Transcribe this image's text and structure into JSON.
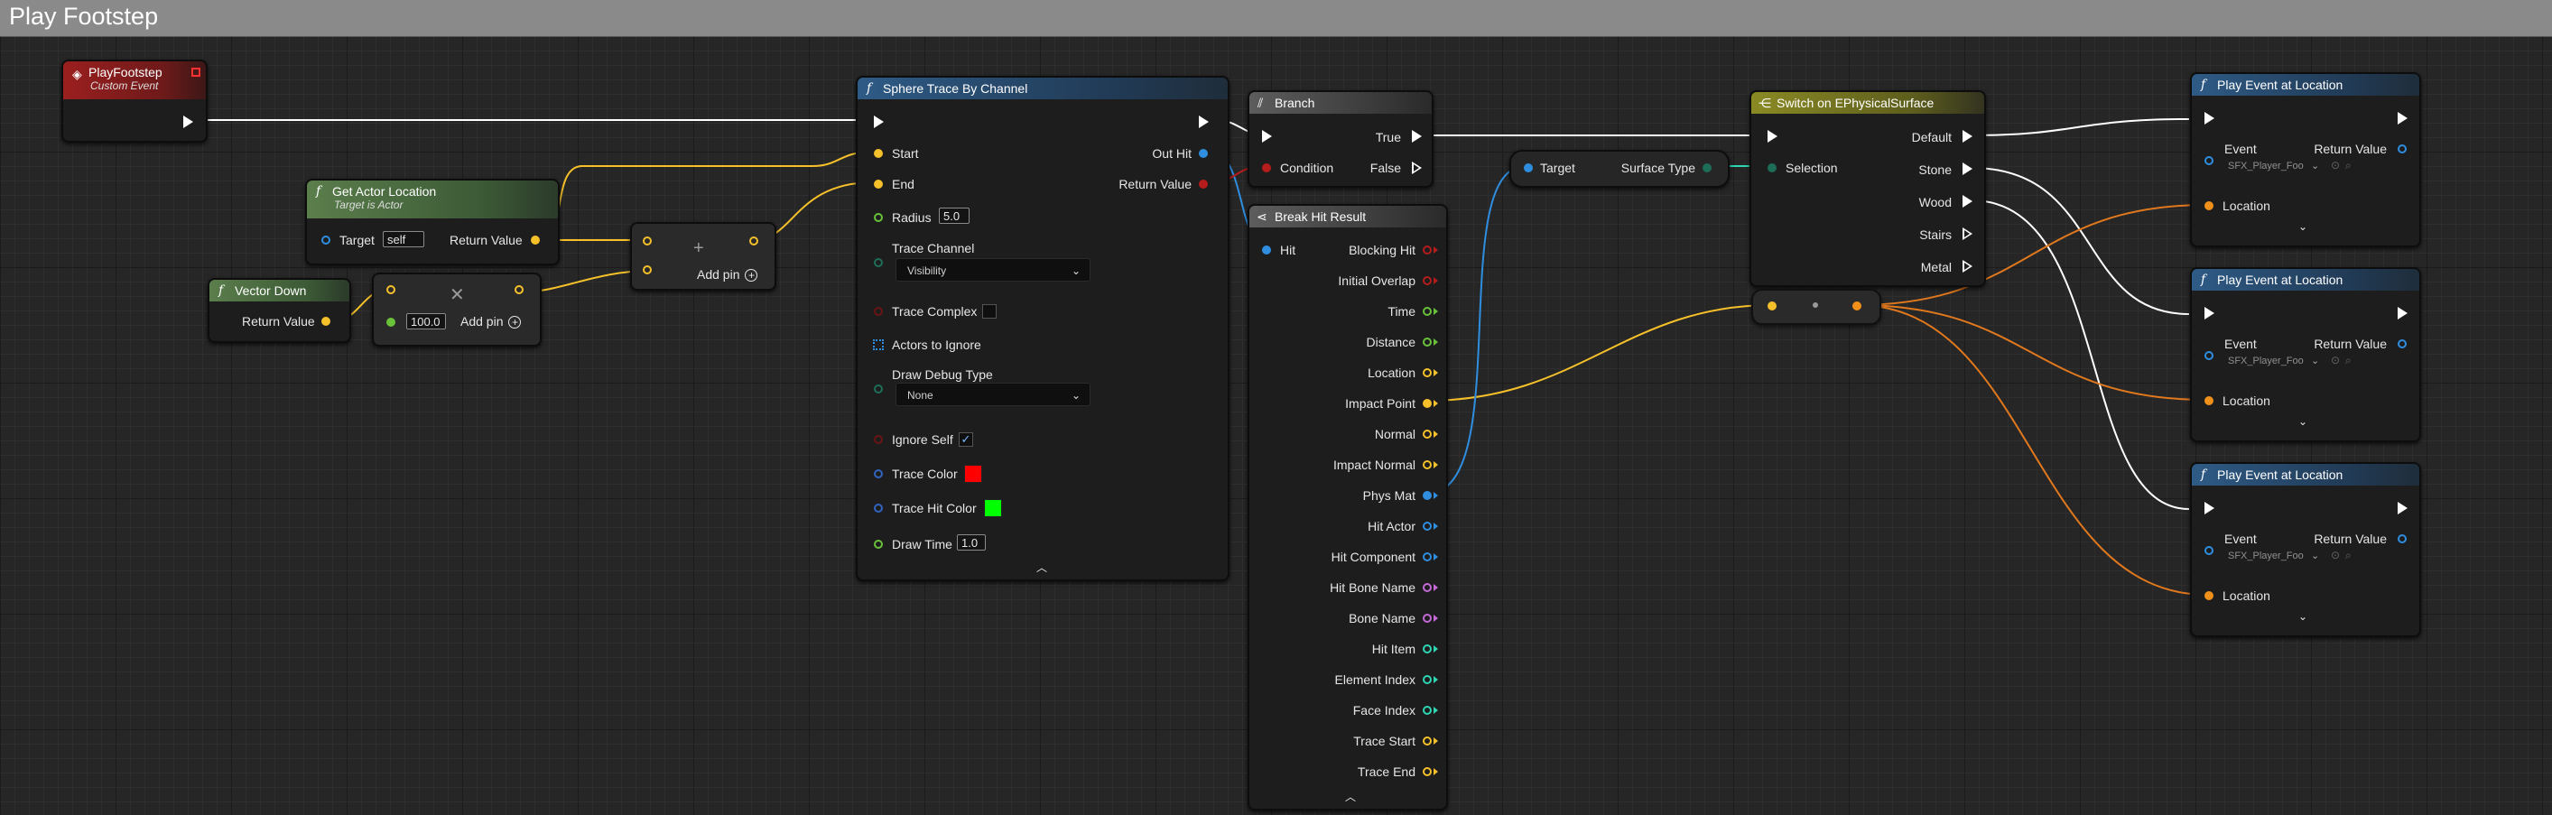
{
  "window": {
    "title": "Play Footstep"
  },
  "colors": {
    "exec": "#ffffff",
    "vector": "#f5c02a",
    "object": "#2f8ee0",
    "bool": "#b51c1c",
    "float": "#69c23a",
    "name": "#c569d8",
    "int": "#2fd6b4",
    "struct": "#f0901a",
    "wire_orange": "#e0781e"
  },
  "nodes": {
    "custom_event": {
      "title": "PlayFootstep",
      "subtitle": "Custom Event",
      "icon": "event-diamond-icon"
    },
    "get_actor_location": {
      "title": "Get Actor Location",
      "subtitle": "Target is Actor",
      "target_label": "Target",
      "target_value": "self",
      "return_label": "Return Value"
    },
    "vector_down": {
      "title": "Vector Down",
      "return_label": "Return Value"
    },
    "multiply": {
      "value": "100.0",
      "add_pin": "Add pin"
    },
    "add": {
      "add_pin": "Add pin"
    },
    "sphere_trace": {
      "title": "Sphere Trace By Channel",
      "start": "Start",
      "end": "End",
      "radius_label": "Radius",
      "radius_value": "5.0",
      "trace_channel_label": "Trace Channel",
      "trace_channel_value": "Visibility",
      "trace_complex": "Trace Complex",
      "actors_to_ignore": "Actors to Ignore",
      "draw_debug_type_label": "Draw Debug Type",
      "draw_debug_type_value": "None",
      "ignore_self": "Ignore Self",
      "ignore_self_checked": true,
      "trace_color": "Trace Color",
      "trace_color_value": "#ff0000",
      "trace_hit_color": "Trace Hit Color",
      "trace_hit_color_value": "#00ff00",
      "draw_time_label": "Draw Time",
      "draw_time_value": "1.0",
      "out_hit": "Out Hit",
      "return_value": "Return Value"
    },
    "branch": {
      "title": "Branch",
      "condition": "Condition",
      "true_label": "True",
      "false_label": "False"
    },
    "break_hit": {
      "title": "Break Hit Result",
      "hit": "Hit",
      "outputs": [
        "Blocking Hit",
        "Initial Overlap",
        "Time",
        "Distance",
        "Location",
        "Impact Point",
        "Normal",
        "Impact Normal",
        "Phys Mat",
        "Hit Actor",
        "Hit Component",
        "Hit Bone Name",
        "Bone Name",
        "Hit Item",
        "Element Index",
        "Face Index",
        "Trace Start",
        "Trace End"
      ],
      "output_types": [
        "bool",
        "bool",
        "float",
        "float",
        "vector",
        "vector",
        "vector",
        "vector",
        "object",
        "object",
        "object",
        "name",
        "name",
        "int",
        "int",
        "int",
        "vector",
        "vector"
      ]
    },
    "get_surface_type": {
      "target": "Target",
      "output": "Surface Type"
    },
    "switch": {
      "title": "Switch on EPhysicalSurface",
      "selection": "Selection",
      "outputs": [
        "Default",
        "Stone",
        "Wood",
        "Stairs",
        "Metal"
      ]
    },
    "play_events": [
      {
        "title": "Play Event at Location",
        "event_label": "Event",
        "event_value": "SFX_Player_Foo",
        "location_label": "Location",
        "return_label": "Return Value"
      },
      {
        "title": "Play Event at Location",
        "event_label": "Event",
        "event_value": "SFX_Player_Foo",
        "location_label": "Location",
        "return_label": "Return Value"
      },
      {
        "title": "Play Event at Location",
        "event_label": "Event",
        "event_value": "SFX_Player_Foo",
        "location_label": "Location",
        "return_label": "Return Value"
      }
    ]
  }
}
